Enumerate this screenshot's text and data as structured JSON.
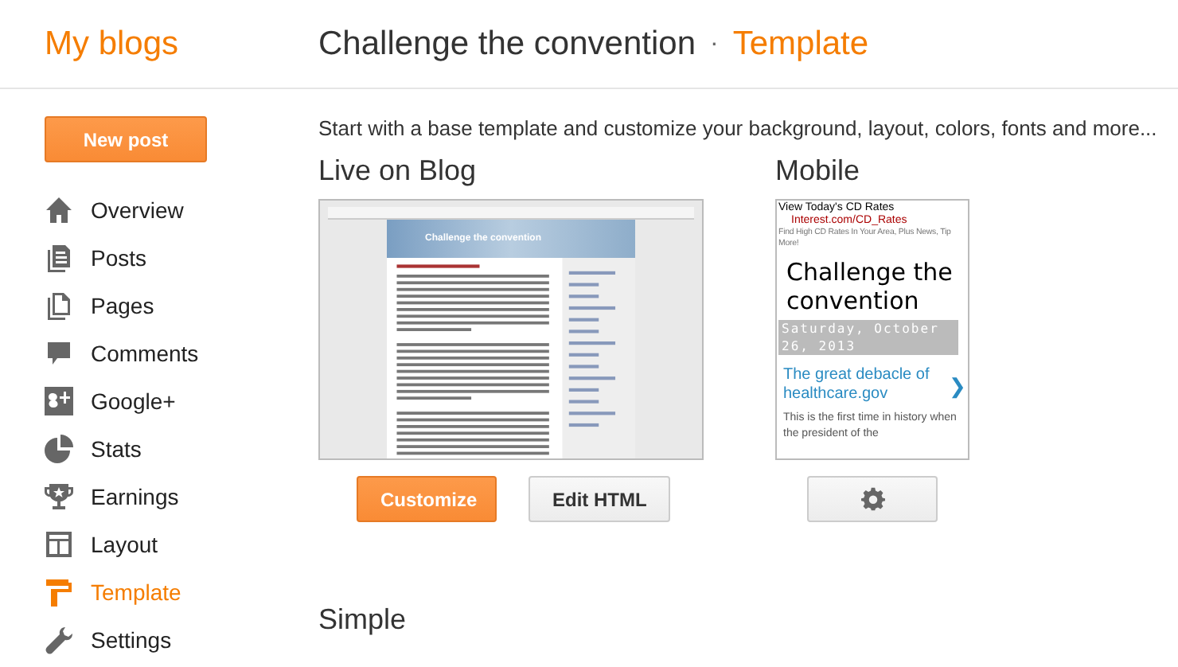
{
  "header": {
    "brand": "My blogs",
    "blog_title": "Challenge the convention",
    "separator": "·",
    "page": "Template"
  },
  "sidebar": {
    "new_post": "New post",
    "items": [
      {
        "label": "Overview",
        "selected": false
      },
      {
        "label": "Posts",
        "selected": false
      },
      {
        "label": "Pages",
        "selected": false
      },
      {
        "label": "Comments",
        "selected": false
      },
      {
        "label": "Google+",
        "selected": false
      },
      {
        "label": "Stats",
        "selected": false
      },
      {
        "label": "Earnings",
        "selected": false
      },
      {
        "label": "Layout",
        "selected": false
      },
      {
        "label": "Template",
        "selected": true
      },
      {
        "label": "Settings",
        "selected": false
      }
    ]
  },
  "intro": "Start with a base template and customize your background, layout, colors, fonts and more...",
  "live": {
    "heading": "Live on Blog",
    "preview_title": "Challenge the convention",
    "buttons": [
      {
        "label": "Customize",
        "kind": "primary"
      },
      {
        "label": "Edit HTML",
        "kind": "secondary"
      }
    ]
  },
  "mobile": {
    "heading": "Mobile",
    "ad_title": "View Today's CD Rates",
    "ad_link": "Interest.com/CD_Rates",
    "ad_text": "Find High CD Rates In Your Area, Plus News, Tip",
    "ad_text_2": "More!",
    "blog_title": "Challenge the convention",
    "date": "Saturday, October 26, 2013",
    "post_title": "The great debacle of healthcare.gov",
    "next": "❯",
    "post_text": "This is the first time in history when the president of the"
  },
  "section": "Simple"
}
